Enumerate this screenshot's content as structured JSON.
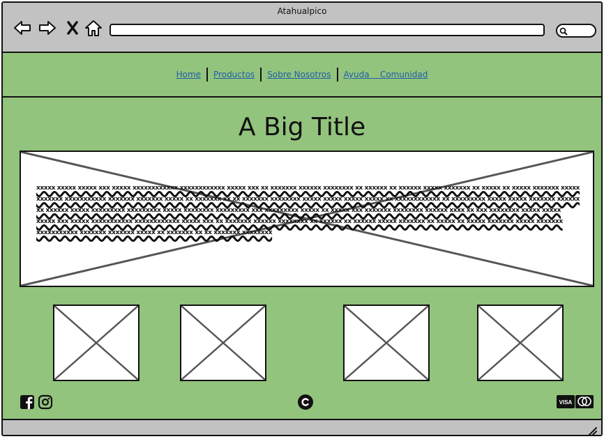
{
  "window": {
    "title": "Atahualpico"
  },
  "browser": {
    "back_icon": "back-arrow-icon",
    "forward_icon": "forward-arrow-icon",
    "close_icon": "close-x-icon",
    "home_icon": "home-icon",
    "url": "",
    "search_icon": "search-icon"
  },
  "nav": {
    "items": [
      {
        "label": "Home"
      },
      {
        "label": "Productos"
      },
      {
        "label": "Sobre Nosotros"
      },
      {
        "label": "Ayuda    Comunidad"
      }
    ]
  },
  "hero": {
    "title": "A Big Title",
    "text": "xxxxx xxxxx xxxxx xxx xxxxx xxxxxxxxxxxx xxxxxxxxxxxx xxxxx xxx xx xxxxxxx xxxxxx xxxxxxxx xx xxxxxx xx xxxxxx xxxxx xxxxxxx xx xxxxx xx xxxxx xxxxxxx xxxxx xxxxxxx xxxxxxxxxxx xxxxxxx xxxxxxx xxxxx xx xxxxxxx xx xx xxxxxxx xxxxxxxx xxxxx xxxxx xxxxx xxxxx xx xxxxxxxxxxxx xx xxxxxxxxx xxxxx xxxxx xxxxxxx xxxxxx xx xxxxxx xxxxx xxxxxxxxx xxxxxxxxx xxxxx xxxxxxxx xxxxxxxxx xxx xxxxxxxxx xxxxx xx xxxxx xxx xxxxxxx xxxxxxxx xxxxxx xxxx xx xxx xxxxxxxx xxxxx xxxxx xxxxx xxx xxxxx xxxxxxxxxxx xxxxxxxxxxxx xxxxx xxx xx xxxxxxx xxxxxx xxxxxxxx xx xxxxxx xx xxxxxx xxxxx xxxxxxx xx xxxxx xx xxxxx xxxxxxx xxxxx xxxxxxx xxxxxxxxxxx xxxxxxx xxxxxxx xxxxx xx xxxxxxx xx xx xxxxxxx xxxxxxxx"
  },
  "footer": {
    "social_icons": [
      "facebook-icon",
      "instagram-icon"
    ],
    "copyright_icon": "copyright-icon",
    "payment_icons": [
      "visa-icon",
      "mastercard-icon"
    ]
  },
  "colors": {
    "page_bg": "#93c47d",
    "chrome_bg": "#c2c2c2",
    "link": "#1f5fa8"
  }
}
